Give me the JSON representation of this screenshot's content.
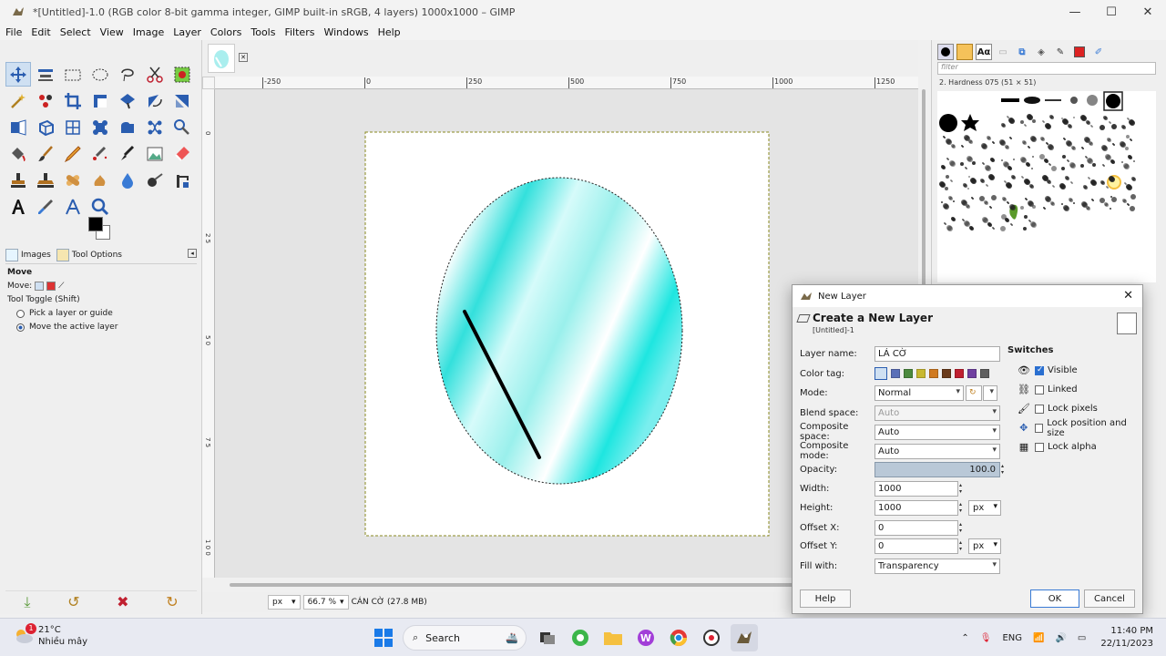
{
  "window": {
    "title": "*[Untitled]-1.0 (RGB color 8-bit gamma integer, GIMP built-in sRGB, 4 layers) 1000x1000 – GIMP",
    "minimize": "—",
    "maximize": "☐",
    "close": "✕"
  },
  "menu": [
    "File",
    "Edit",
    "Select",
    "View",
    "Image",
    "Layer",
    "Colors",
    "Tools",
    "Filters",
    "Windows",
    "Help"
  ],
  "toolbox": {
    "tabs": [
      "Images",
      "Tool Options"
    ],
    "tool_name": "Move",
    "move_label": "Move:",
    "toggle_label": "Tool Toggle  (Shift)",
    "options": [
      "Pick a layer or guide",
      "Move the active layer"
    ]
  },
  "ruler": {
    "top_ticks": [
      "-250",
      "0",
      "250",
      "500",
      "750",
      "1000",
      "1250"
    ],
    "left_ticks": [
      "0",
      "2\n5",
      "5\n0",
      "7\n5",
      "1\n0\n0"
    ]
  },
  "statusbar": {
    "unit": "px",
    "zoom": "66.7 %",
    "layer_info": "CÁN CỜ (27.8 MB)"
  },
  "brushes": {
    "filter_placeholder": "filter",
    "selected": "2. Hardness 075 (51 × 51)",
    "tab_text": "Aα"
  },
  "dialog": {
    "window_title": "New Layer",
    "header": "Create a New Layer",
    "subheader": "[Untitled]-1",
    "labels": {
      "layer_name": "Layer name:",
      "color_tag": "Color tag:",
      "mode": "Mode:",
      "blend_space": "Blend space:",
      "composite_space": "Composite space:",
      "composite_mode": "Composite mode:",
      "opacity": "Opacity:",
      "width": "Width:",
      "height": "Height:",
      "offset_x": "Offset X:",
      "offset_y": "Offset Y:",
      "fill_with": "Fill with:"
    },
    "values": {
      "layer_name": "LÁ CỜ",
      "mode": "Normal",
      "blend_space": "Auto",
      "composite_space": "Auto",
      "composite_mode": "Auto",
      "opacity": "100.0",
      "opacity_fraction": 1.0,
      "width": "1000",
      "height": "1000",
      "size_unit": "px",
      "offset_x": "0",
      "offset_y": "0",
      "offset_unit": "px",
      "fill_with": "Transparency"
    },
    "color_tags": [
      "#5a6fb8",
      "#4c8a3e",
      "#c8b830",
      "#d07a20",
      "#6a3a1a",
      "#c02030",
      "#7040a0",
      "#606060"
    ],
    "switches_title": "Switches",
    "switches": [
      {
        "label": "Visible",
        "checked": true,
        "icon": "eye-icon"
      },
      {
        "label": "Linked",
        "checked": false,
        "icon": "chain-icon"
      },
      {
        "label": "Lock pixels",
        "checked": false,
        "icon": "brush-icon"
      },
      {
        "label": "Lock position and size",
        "checked": false,
        "icon": "move-icon"
      },
      {
        "label": "Lock alpha",
        "checked": false,
        "icon": "checker-icon"
      }
    ],
    "buttons": {
      "help": "Help",
      "ok": "OK",
      "cancel": "Cancel"
    }
  },
  "taskbar": {
    "temp": "21°C",
    "weather": "Nhiều mây",
    "badge": "1",
    "search": "Search",
    "lang": "ENG",
    "time": "11:40 PM",
    "date": "22/11/2023"
  }
}
